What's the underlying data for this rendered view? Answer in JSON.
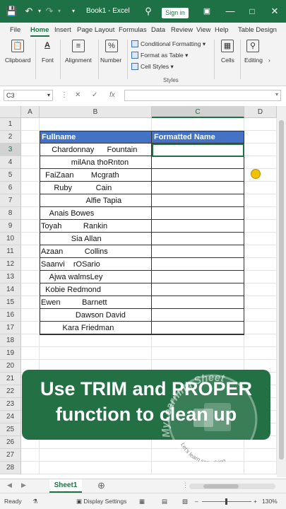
{
  "titlebar": {
    "title": "Book1 - Excel",
    "signin": "Sign in"
  },
  "menu": {
    "tabs": [
      "File",
      "Home",
      "Insert",
      "Page Layout",
      "Formulas",
      "Data",
      "Review",
      "View",
      "Help",
      "Table Design"
    ]
  },
  "ribbon": {
    "clipboard": "Clipboard",
    "font": "Font",
    "alignment": "Alignment",
    "number": "Number",
    "conditional_formatting": "Conditional Formatting",
    "format_as_table": "Format as Table",
    "cell_styles": "Cell Styles",
    "styles": "Styles",
    "cells": "Cells",
    "editing": "Editing"
  },
  "formula_bar": {
    "name_box": "C3",
    "fx": "fx",
    "value": ""
  },
  "grid": {
    "columns": [
      "A",
      "B",
      "C",
      "D"
    ],
    "rows": [
      "1",
      "2",
      "3",
      "4",
      "5",
      "6",
      "7",
      "8",
      "9",
      "10",
      "11",
      "12",
      "13",
      "14",
      "15",
      "16",
      "17",
      "18",
      "19",
      "20",
      "21",
      "22",
      "23",
      "24",
      "25",
      "26",
      "27",
      "28"
    ],
    "header": {
      "fullname": "Fullname",
      "formatted": "Formatted Name"
    },
    "names": [
      "     Chardonnay      Fountain",
      "              milAna thoRnton",
      "  FaiZaan        Mcgrath",
      "      Ruby           Cain",
      "                     Alfie Tapia",
      "    Anais Bowes",
      "Toyah          Rankin",
      "              Sia Allan",
      "Azaan          Collins",
      "Saanvi    rOSario",
      "    Ajwa walmsLey",
      "  Kobie Redmond",
      "Ewen          Barnett",
      "                Dawson David",
      "          Kara Friedman"
    ]
  },
  "banner": {
    "line1": "Use TRIM and PROPER",
    "line2": "function to clean up"
  },
  "watermark": {
    "brand": "MyLearning Sheet",
    "tagline": "Let's learn something"
  },
  "sheets": {
    "active": "Sheet1"
  },
  "status": {
    "ready": "Ready",
    "display_settings": "Display Settings",
    "zoom": "130%"
  },
  "colors": {
    "excel_green": "#1e7145",
    "table_header": "#4472c4",
    "banner": "#237044"
  }
}
